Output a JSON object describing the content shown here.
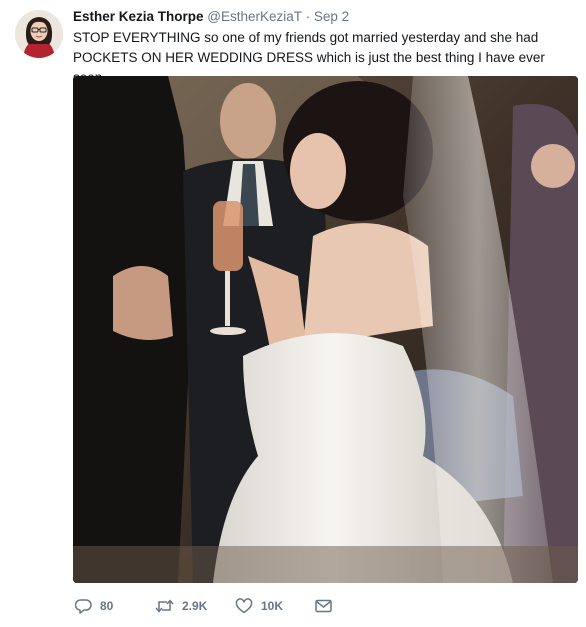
{
  "tweet": {
    "author_name": "Esther Kezia Thorpe",
    "handle": "@EstherKeziaT",
    "separator": "·",
    "date": "Sep 2",
    "text": "STOP EVERYTHING so one of my friends got married yesterday and she had POCKETS ON HER WEDDING DRESS which is just the best thing I have ever seen.",
    "avatar_icon": "profile-photo",
    "media_icon": "wedding-photo"
  },
  "actions": {
    "reply_count": "80",
    "retweet_count": "2.9K",
    "like_count": "10K",
    "icons": [
      "reply-icon",
      "retweet-icon",
      "like-icon",
      "direct-message-icon"
    ]
  },
  "colors": {
    "text": "#14171a",
    "secondary": "#657786",
    "background": "#ffffff"
  }
}
